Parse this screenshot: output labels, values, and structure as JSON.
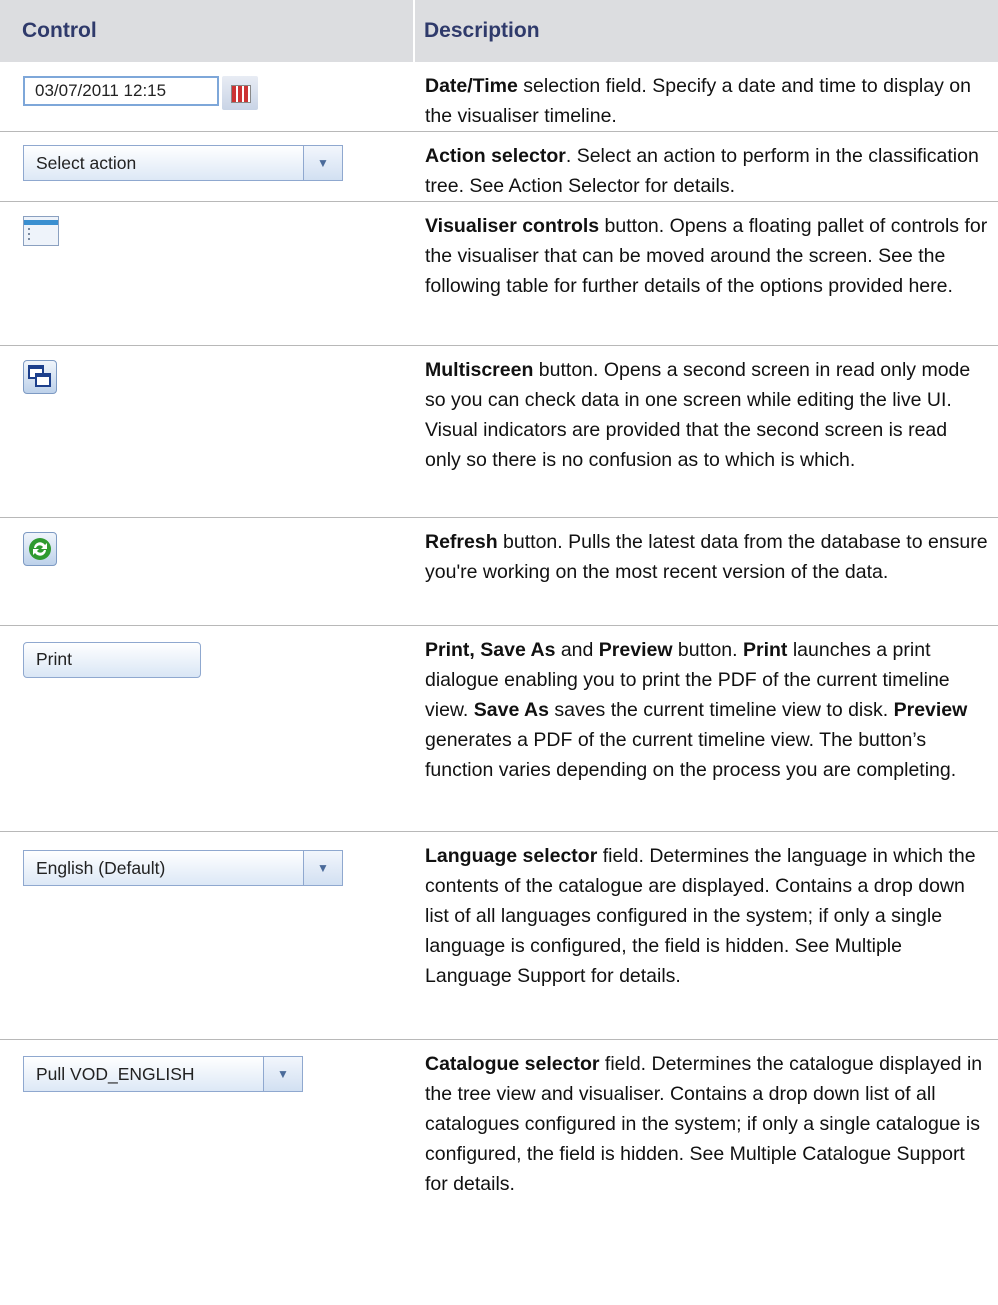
{
  "header": {
    "control": "Control",
    "description": "Description"
  },
  "rows": [
    {
      "control": {
        "kind": "datetime",
        "value": "03/07/2011 12:15",
        "icon": "calendar-icon"
      },
      "description": [
        {
          "b": "Date/Time"
        },
        {
          "t": " selection field. Specify a date and time to display on the visualiser timeline."
        }
      ]
    },
    {
      "control": {
        "kind": "select",
        "value": "Select action"
      },
      "description": [
        {
          "b": "Action selector"
        },
        {
          "t": ". Select an action to perform in the classification tree. See Action Selector for details."
        }
      ]
    },
    {
      "control": {
        "kind": "icon",
        "icon": "visualiser-controls-icon"
      },
      "description": [
        {
          "b": "Visualiser controls"
        },
        {
          "t": " button. Opens a floating pallet of controls for the visualiser that can be moved around the screen. See the following table for further details of the options provided here."
        }
      ]
    },
    {
      "control": {
        "kind": "icon",
        "icon": "multiscreen-icon"
      },
      "description": [
        {
          "b": "Multiscreen"
        },
        {
          "t": " button. Opens a second screen in read only mode so you can check data in one screen while editing the live UI. Visual indicators are provided that the second screen is read only so there is no confusion as to which is which."
        }
      ]
    },
    {
      "control": {
        "kind": "icon",
        "icon": "refresh-icon"
      },
      "description": [
        {
          "b": "Refresh"
        },
        {
          "t": " button. Pulls the latest data from the database to ensure you're working on the most recent version of the data."
        }
      ]
    },
    {
      "control": {
        "kind": "button",
        "value": "Print"
      },
      "description": [
        {
          "b": "Print, Save As"
        },
        {
          "t": " and "
        },
        {
          "b": "Preview"
        },
        {
          "t": " button. "
        },
        {
          "b": "Print"
        },
        {
          "t": " launches a print dialogue enabling you to print the PDF of the current timeline view. "
        },
        {
          "b": "Save As"
        },
        {
          "t": " saves the current timeline view to disk. "
        },
        {
          "b": "Preview"
        },
        {
          "t": " generates a PDF of the current timeline view.  The button’s function varies depending on the process you are completing."
        }
      ]
    },
    {
      "control": {
        "kind": "select",
        "value": "English (Default)"
      },
      "description": [
        {
          "b": "Language selector"
        },
        {
          "t": " field. Determines the language in which the contents of the catalogue are displayed. Contains a drop down list of all languages configured in the system; if only a single language is configured, the field is hidden. See Multiple Language Support for details."
        }
      ]
    },
    {
      "control": {
        "kind": "select",
        "value": "Pull VOD_ENGLISH"
      },
      "description": [
        {
          "b": "Catalogue selector"
        },
        {
          "t": " field. Determines the catalogue displayed in the tree view and visualiser. Contains a drop down list of all catalogues configured in the system; if only a single catalogue is configured, the field is hidden. See Multiple Catalogue Support for details."
        }
      ]
    }
  ]
}
